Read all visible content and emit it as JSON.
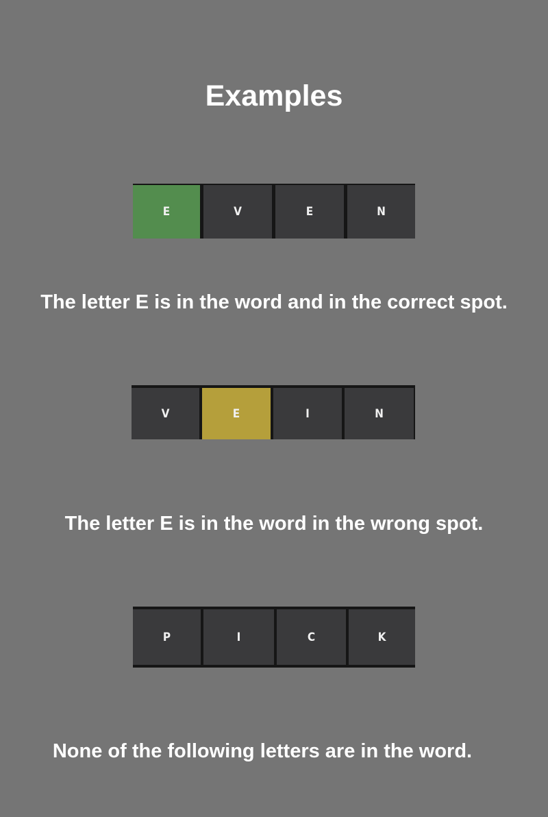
{
  "title": "Examples",
  "examples": [
    {
      "tiles": [
        {
          "letter": "E",
          "state": "correct"
        },
        {
          "letter": "V",
          "state": "absent"
        },
        {
          "letter": "E",
          "state": "absent"
        },
        {
          "letter": "N",
          "state": "absent"
        }
      ],
      "description": "The letter E is in the word and in the correct spot."
    },
    {
      "tiles": [
        {
          "letter": "V",
          "state": "absent"
        },
        {
          "letter": "E",
          "state": "present"
        },
        {
          "letter": "I",
          "state": "absent"
        },
        {
          "letter": "N",
          "state": "absent"
        }
      ],
      "description": "The letter E is in the word in the wrong spot."
    },
    {
      "tiles": [
        {
          "letter": "P",
          "state": "absent"
        },
        {
          "letter": "I",
          "state": "absent"
        },
        {
          "letter": "C",
          "state": "absent"
        },
        {
          "letter": "K",
          "state": "absent"
        }
      ],
      "description": "None of the following letters are in the word."
    }
  ],
  "colors": {
    "background": "#757575",
    "correct": "#538d4e",
    "present": "#b59f3b",
    "absent": "#3a3a3c",
    "text": "#ffffff"
  }
}
